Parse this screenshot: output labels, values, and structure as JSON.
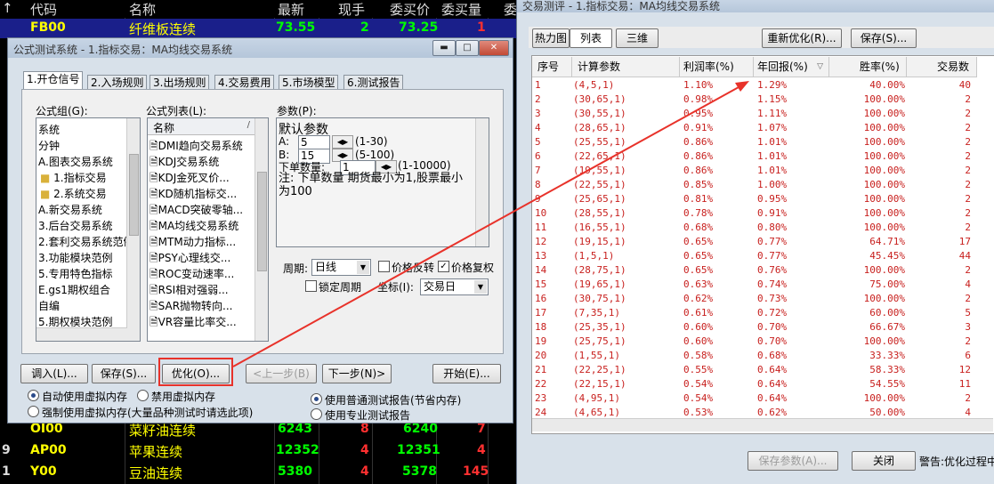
{
  "quote_table": {
    "headers": [
      "代码",
      "名称",
      "最新",
      "现手",
      "委买价",
      "委买量",
      "委"
    ],
    "rows_top": [
      {
        "code": "FB00",
        "name": "纤维板连续",
        "last": "73.55",
        "hand": "2",
        "bid": "73.25",
        "bidvol": "1"
      }
    ],
    "rows_bottom": [
      {
        "idx": "",
        "code": "OI00",
        "name": "菜籽油连续",
        "last": "6243",
        "hand": "8",
        "bid": "6240",
        "bidvol": "7"
      },
      {
        "idx": "9",
        "code": "AP00",
        "name": "苹果连续",
        "last": "12352",
        "hand": "4",
        "bid": "12351",
        "bidvol": "4"
      },
      {
        "idx": "1",
        "code": "Y00",
        "name": "豆油连续",
        "last": "5380",
        "hand": "4",
        "bid": "5378",
        "bidvol": "145"
      }
    ]
  },
  "left_dialog": {
    "title": "公式测试系统 - 1.指标交易：MA均线交易系统",
    "tabs": [
      "1.开仓信号",
      "2.入场规则",
      "3.出场规则",
      "4.交易费用",
      "5.市场模型",
      "6.测试报告"
    ],
    "formula_group_label": "公式组(G):",
    "formula_groups": [
      "系统",
      "分钟",
      "A.图表交易系统",
      "1.指标交易",
      "2.系统交易",
      "A.新交易系统",
      "3.后台交易系统",
      "2.套利交易系统范例",
      "3.功能模块范例",
      "5.专用特色指标",
      "E.gs1期权组合",
      "自编",
      "5.期权模块范例"
    ],
    "formula_list_label": "公式列表(L):",
    "formula_list_header": "名称",
    "formula_list": [
      "DMI趋向交易系统",
      "KDJ交易系统",
      "KDJ金死叉价...",
      "KD随机指标交...",
      "MACD突破零轴...",
      "MA均线交易系统",
      "MTM动力指标...",
      "PSY心理线交...",
      "ROC变动速率...",
      "RSI相对强弱...",
      "SAR抛物转向...",
      "VR容量比率交..."
    ],
    "params_label": "参数(P):",
    "params_title": "默认参数",
    "param_a_label": "A:",
    "param_a_value": "5",
    "param_a_range": "(1-30)",
    "param_b_label": "B:",
    "param_b_value": "15",
    "param_b_range": "(5-100)",
    "order_qty_label": "下单数量:",
    "order_qty_value": "1",
    "order_qty_range": "(1-10000)",
    "note": "注: 下单数量 期货最小为1,股票最小为100",
    "period_label": "周期:",
    "period_value": "日线",
    "price_reverse_label": "价格反转",
    "price_restore_label": "价格复权",
    "lock_period_label": "锁定周期",
    "axis_label": "坐标(I):",
    "axis_value": "交易日",
    "buttons": {
      "load": "调入(L)...",
      "save": "保存(S)...",
      "optimize": "优化(O)...",
      "prev": "<上一步(B)",
      "next": "下一步(N)>",
      "start": "开始(E)..."
    },
    "mem_auto": "自动使用虚拟内存",
    "mem_disable": "禁用虚拟内存",
    "mem_force": "强制使用虚拟内存(大量品种测试时请选此项)",
    "report_normal": "使用普通测试报告(节省内存)",
    "report_pro": "使用专业测试报告"
  },
  "right_dialog": {
    "title": "交易测评 - 1.指标交易：MA均线交易系统",
    "view_tabs": [
      "热力图",
      "列表",
      "三维"
    ],
    "reoptimize_button": "重新优化(R)...",
    "save_button": "保存(S)...",
    "columns": [
      "序号",
      "计算参数",
      "利润率(%)",
      "年回报(%)",
      "胜率(%)",
      "交易数"
    ],
    "rows": [
      [
        "1",
        "(4,5,1)",
        "1.10%",
        "1.29%",
        "40.00%",
        "40"
      ],
      [
        "2",
        "(30,65,1)",
        "0.98%",
        "1.15%",
        "100.00%",
        "2"
      ],
      [
        "3",
        "(30,55,1)",
        "0.95%",
        "1.11%",
        "100.00%",
        "2"
      ],
      [
        "4",
        "(28,65,1)",
        "0.91%",
        "1.07%",
        "100.00%",
        "2"
      ],
      [
        "5",
        "(25,55,1)",
        "0.86%",
        "1.01%",
        "100.00%",
        "2"
      ],
      [
        "6",
        "(22,65,1)",
        "0.86%",
        "1.01%",
        "100.00%",
        "2"
      ],
      [
        "7",
        "(19,55,1)",
        "0.86%",
        "1.01%",
        "100.00%",
        "2"
      ],
      [
        "8",
        "(22,55,1)",
        "0.85%",
        "1.00%",
        "100.00%",
        "2"
      ],
      [
        "9",
        "(25,65,1)",
        "0.81%",
        "0.95%",
        "100.00%",
        "2"
      ],
      [
        "10",
        "(28,55,1)",
        "0.78%",
        "0.91%",
        "100.00%",
        "2"
      ],
      [
        "11",
        "(16,55,1)",
        "0.68%",
        "0.80%",
        "100.00%",
        "2"
      ],
      [
        "12",
        "(19,15,1)",
        "0.65%",
        "0.77%",
        "64.71%",
        "17"
      ],
      [
        "13",
        "(1,5,1)",
        "0.65%",
        "0.77%",
        "45.45%",
        "44"
      ],
      [
        "14",
        "(28,75,1)",
        "0.65%",
        "0.76%",
        "100.00%",
        "2"
      ],
      [
        "15",
        "(19,65,1)",
        "0.63%",
        "0.74%",
        "75.00%",
        "4"
      ],
      [
        "16",
        "(30,75,1)",
        "0.62%",
        "0.73%",
        "100.00%",
        "2"
      ],
      [
        "17",
        "(7,35,1)",
        "0.61%",
        "0.72%",
        "60.00%",
        "5"
      ],
      [
        "18",
        "(25,35,1)",
        "0.60%",
        "0.70%",
        "66.67%",
        "3"
      ],
      [
        "19",
        "(25,75,1)",
        "0.60%",
        "0.70%",
        "100.00%",
        "2"
      ],
      [
        "20",
        "(1,55,1)",
        "0.58%",
        "0.68%",
        "33.33%",
        "6"
      ],
      [
        "21",
        "(22,25,1)",
        "0.55%",
        "0.64%",
        "58.33%",
        "12"
      ],
      [
        "22",
        "(22,15,1)",
        "0.54%",
        "0.64%",
        "54.55%",
        "11"
      ],
      [
        "23",
        "(4,95,1)",
        "0.54%",
        "0.64%",
        "100.00%",
        "2"
      ],
      [
        "24",
        "(4,65,1)",
        "0.53%",
        "0.62%",
        "50.00%",
        "4"
      ]
    ],
    "save_params_button": "保存参数(A)...",
    "close_button": "关闭",
    "warning_text": "警告:优化过程中"
  },
  "colors": {
    "table_red": "#c8201e",
    "highlight_box": "#e8322a",
    "quote_yellow": "#ffff00",
    "quote_green": "#00ff00",
    "quote_red": "#ff3030"
  }
}
